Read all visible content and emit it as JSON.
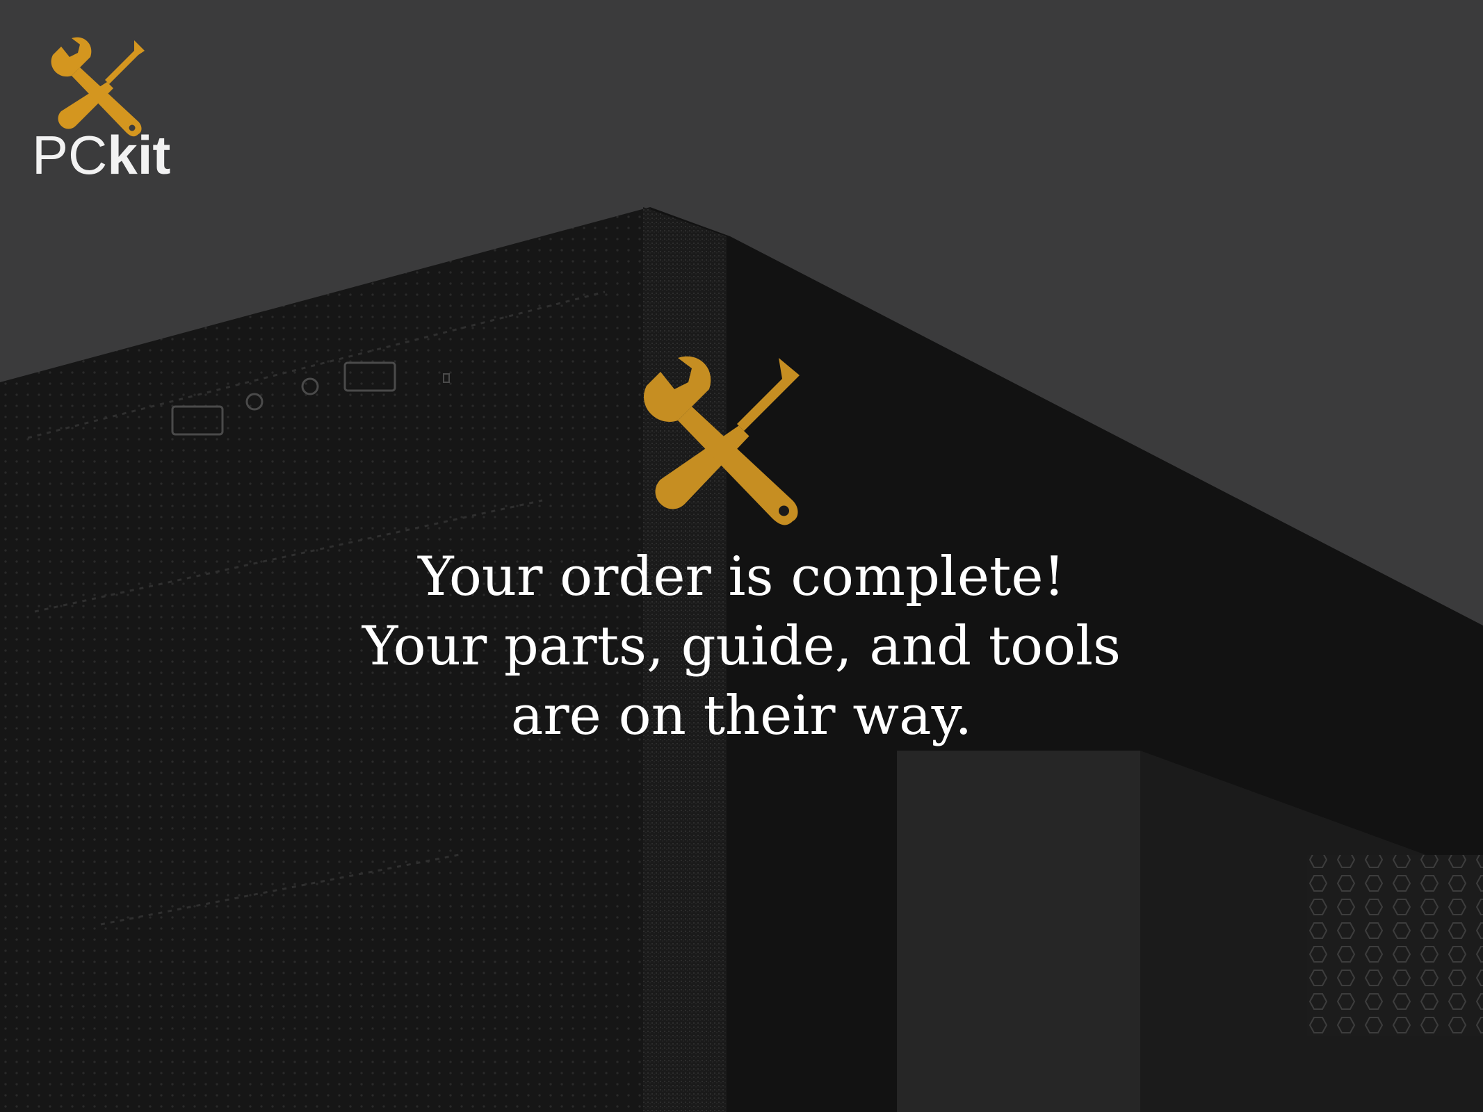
{
  "brand": {
    "name_part1": "PC",
    "name_part2": "kit",
    "logo_icon": "wrench-screwdriver-crossed-icon",
    "accent_color": "#d4961f"
  },
  "confirmation": {
    "icon": "wrench-screwdriver-crossed-icon",
    "line1": "Your order is complete!",
    "line2": "Your parts, guide, and tools",
    "line3": "are on their way."
  },
  "colors": {
    "background": "#3b3b3c",
    "case_dark": "#161616",
    "text": "#ffffff"
  }
}
